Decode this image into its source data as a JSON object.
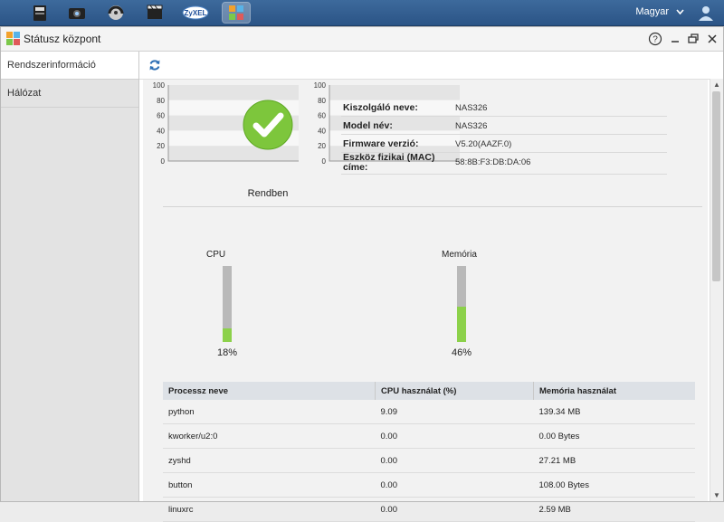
{
  "taskbar": {
    "apps": [
      {
        "name": "file-browser-app-icon"
      },
      {
        "name": "photo-app-icon"
      },
      {
        "name": "music-app-icon"
      },
      {
        "name": "video-app-icon"
      },
      {
        "name": "zyxel-app-icon",
        "text": "ZyXEL"
      },
      {
        "name": "status-center-app-icon"
      }
    ],
    "language": "Magyar"
  },
  "window": {
    "title": "Státusz központ"
  },
  "sidebar": {
    "items": [
      {
        "label": "Rendszerinformáció"
      },
      {
        "label": "Hálózat"
      }
    ]
  },
  "status": {
    "text": "Rendben",
    "color": "#7dc63c"
  },
  "info": [
    {
      "label": "Kiszolgáló neve:",
      "value": "NAS326"
    },
    {
      "label": "Model név:",
      "value": "NAS326"
    },
    {
      "label": "Firmware verzió:",
      "value": "V5.20(AAZF.0)"
    },
    {
      "label": "Eszköz fizikai (MAC) címe:",
      "value": "58:8B:F3:DB:DA:06"
    }
  ],
  "meters": {
    "cpu": {
      "label": "CPU",
      "value": 18,
      "text": "18%"
    },
    "memory": {
      "label": "Memória",
      "value": 46,
      "text": "46%"
    }
  },
  "graph_ticks": [
    "100",
    "80",
    "60",
    "40",
    "20",
    "0"
  ],
  "process_table": {
    "headers": [
      "Processz neve",
      "CPU használat (%)",
      "Memória használat"
    ],
    "rows": [
      [
        "python",
        "9.09",
        "139.34 MB"
      ],
      [
        "kworker/u2:0",
        "0.00",
        "0.00 Bytes"
      ],
      [
        "zyshd",
        "0.00",
        "27.21 MB"
      ],
      [
        "button",
        "0.00",
        "108.00 Bytes"
      ],
      [
        "linuxrc",
        "0.00",
        "2.59 MB"
      ]
    ]
  },
  "colors": {
    "accent": "#2b5486",
    "meter_fill": "#8cd14a",
    "meter_bg": "#b9b9b9"
  }
}
